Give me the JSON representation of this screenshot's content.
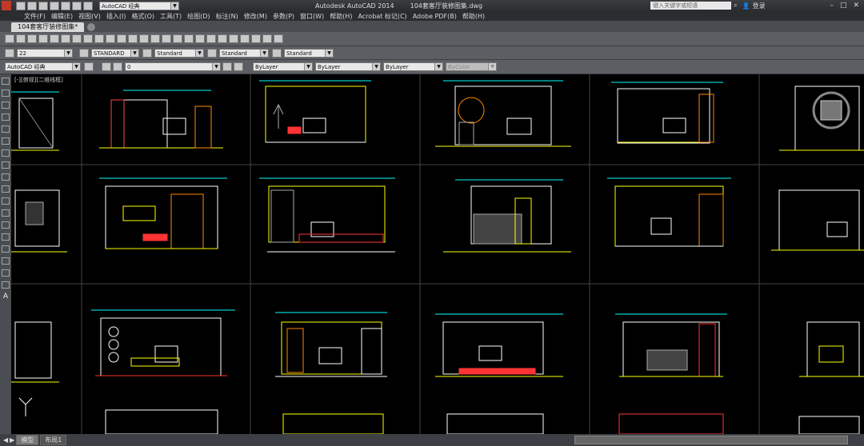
{
  "titlebar": {
    "workspace": "AutoCAD 经典",
    "app_title": "Autodesk AutoCAD 2014",
    "file_name": "104套客厅装修图集.dwg",
    "search_placeholder": "键入关键字或短语",
    "login_label": "登录"
  },
  "menu": [
    "文件(F)",
    "编辑(E)",
    "视图(V)",
    "插入(I)",
    "格式(O)",
    "工具(T)",
    "绘图(D)",
    "标注(N)",
    "修改(M)",
    "参数(P)",
    "窗口(W)",
    "帮助(H)",
    "Acrobat 标记(C)",
    "Adobe PDF(B)",
    "帮助(H)"
  ],
  "doc_tab": "104套客厅装修图集*",
  "toolbar2": {
    "text_height": "22",
    "text_style": "STANDARD",
    "dim_style": "Standard",
    "table_style": "Standard",
    "mleader_style": "Standard"
  },
  "toolbar3": {
    "workspace": "AutoCAD 经典",
    "layer": "0",
    "color": "ByLayer",
    "linetype": "ByLayer",
    "lineweight": "ByLayer",
    "plotstyle": "ByColor"
  },
  "viewport_label": "[-][俯视][二维线框]",
  "bottom_tabs": [
    "模型",
    "布局1"
  ],
  "colors": {
    "accent": "#ffff00",
    "lines": "#ffffff",
    "dims": "#00ffff",
    "bg": "#000000"
  }
}
